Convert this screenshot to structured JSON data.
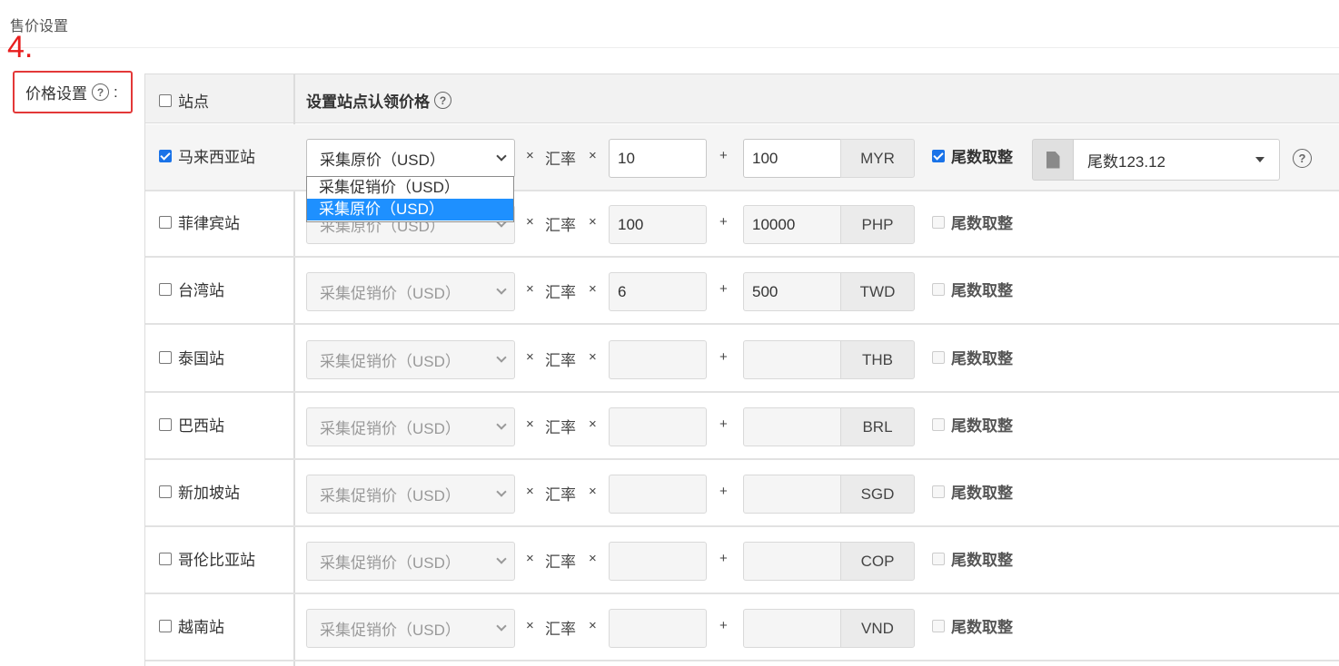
{
  "section_title": "售价设置",
  "step_annotation": "4.",
  "price_setting": {
    "label": "价格设置",
    "help": "?",
    "colon": ":"
  },
  "table_header": {
    "site_label": "站点",
    "price_label": "设置站点认领价格",
    "help": "?"
  },
  "ops": {
    "times": "×",
    "rate": "汇率",
    "plus": "+"
  },
  "rows": [
    {
      "site": "马来西亚站",
      "checked": true,
      "source": "采集原价（USD）",
      "multiplier": "10",
      "addend": "100",
      "currency": "MYR",
      "round_label": "尾数取整",
      "round_checked": true,
      "tail_value": "尾数123.12",
      "help": "?"
    },
    {
      "site": "菲律宾站",
      "checked": false,
      "source": "采集原价（USD）",
      "multiplier": "100",
      "addend": "10000",
      "currency": "PHP",
      "round_label": "尾数取整",
      "round_checked": false
    },
    {
      "site": "台湾站",
      "checked": false,
      "source": "采集促销价（USD）",
      "multiplier": "6",
      "addend": "500",
      "currency": "TWD",
      "round_label": "尾数取整",
      "round_checked": false
    },
    {
      "site": "泰国站",
      "checked": false,
      "source": "采集促销价（USD）",
      "multiplier": "",
      "addend": "",
      "currency": "THB",
      "round_label": "尾数取整",
      "round_checked": false
    },
    {
      "site": "巴西站",
      "checked": false,
      "source": "采集促销价（USD）",
      "multiplier": "",
      "addend": "",
      "currency": "BRL",
      "round_label": "尾数取整",
      "round_checked": false
    },
    {
      "site": "新加坡站",
      "checked": false,
      "source": "采集促销价（USD）",
      "multiplier": "",
      "addend": "",
      "currency": "SGD",
      "round_label": "尾数取整",
      "round_checked": false
    },
    {
      "site": "哥伦比亚站",
      "checked": false,
      "source": "采集促销价（USD）",
      "multiplier": "",
      "addend": "",
      "currency": "COP",
      "round_label": "尾数取整",
      "round_checked": false
    },
    {
      "site": "越南站",
      "checked": false,
      "source": "采集促销价（USD）",
      "multiplier": "",
      "addend": "",
      "currency": "VND",
      "round_label": "尾数取整",
      "round_checked": false
    }
  ],
  "dropdown": {
    "options": [
      "采集促销价（USD）",
      "采集原价（USD）"
    ],
    "selected": "采集原价（USD）"
  },
  "colors": {
    "accent": "#1e90ff",
    "annotation": "#e81e1e",
    "checkbox": "#1a73e8"
  }
}
